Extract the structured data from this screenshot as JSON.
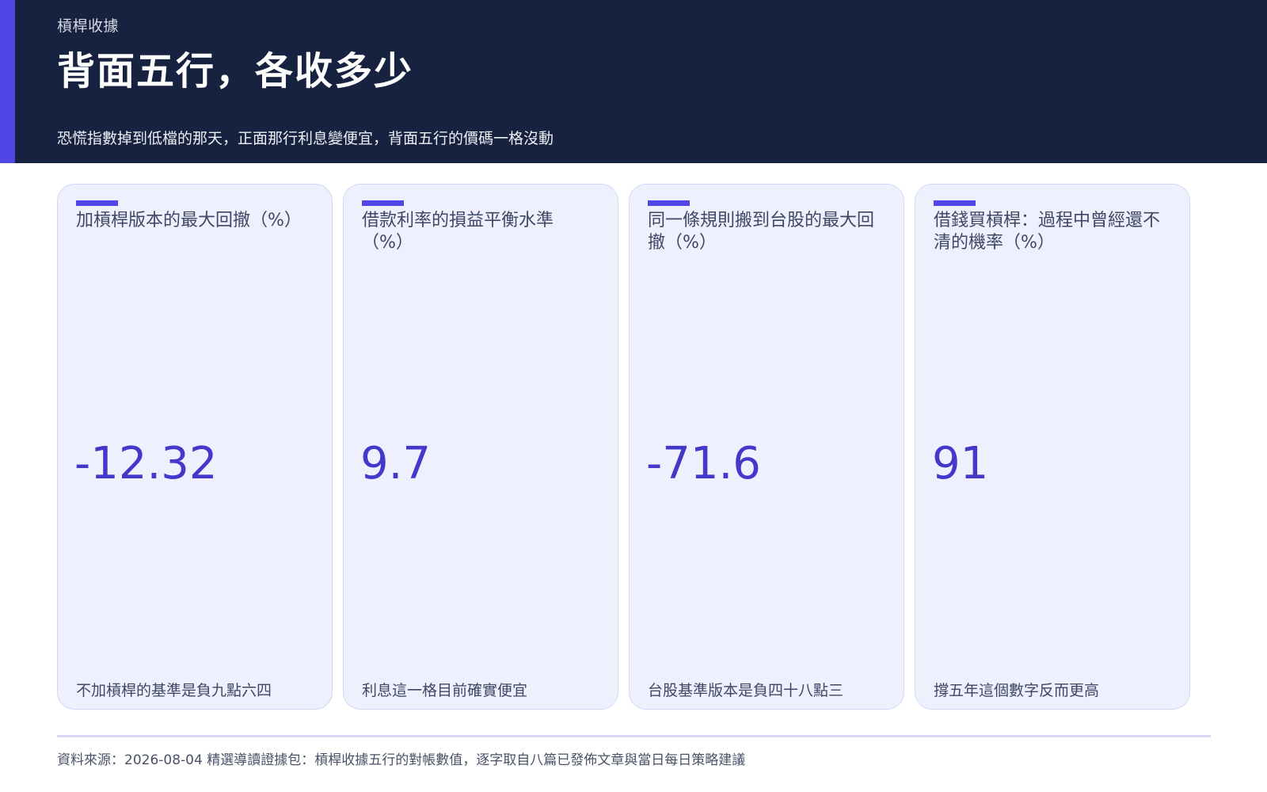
{
  "header": {
    "eyebrow": "槓桿收據",
    "title": "背面五行，各收多少",
    "subtitle": "恐慌指數掉到低檔的那天，正面那行利息變便宜，背面五行的價碼一格沒動"
  },
  "cards": [
    {
      "label": "加槓桿版本的最大回撤（%）",
      "value": "-12.32",
      "note": "不加槓桿的基準是負九點六四"
    },
    {
      "label": "借款利率的損益平衡水準（%）",
      "value": "9.7",
      "note": "利息這一格目前確實便宜"
    },
    {
      "label": "同一條規則搬到台股的最大回撤（%）",
      "value": "-71.6",
      "note": "台股基準版本是負四十八點三"
    },
    {
      "label": "借錢買槓桿：過程中曾經還不清的機率（%）",
      "value": "91",
      "note": "撐五年這個數字反而更高"
    }
  ],
  "footer": {
    "source": "資料來源：2026-08-04 精選導讀證據包：槓桿收據五行的對帳數值，逐字取自八篇已發佈文章與當日每日策略建議"
  },
  "colors": {
    "header_bg": "#16223f",
    "accent": "#4f46e5",
    "card_bg": "#eff0fd",
    "value": "#4338ca"
  }
}
